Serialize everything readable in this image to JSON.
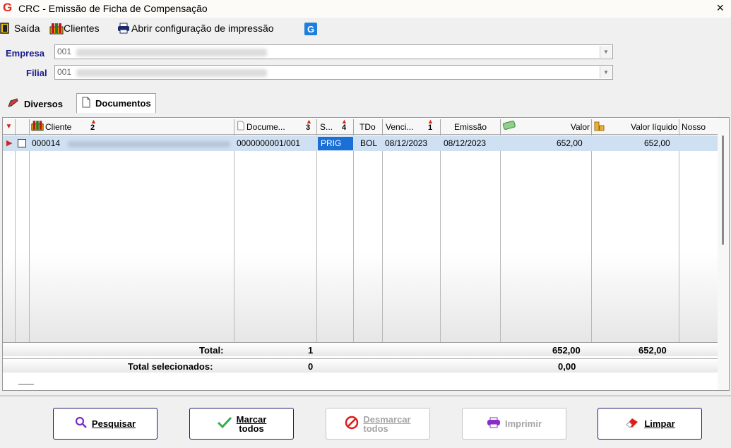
{
  "window": {
    "title": "CRC - Emissão de Ficha de Compensação",
    "close": "×"
  },
  "toolbar": {
    "exit_label": "Saída",
    "clients_label": "Clientes",
    "print_config_label": "Abrir configuração de impressão"
  },
  "form": {
    "empresa_label": "Empresa",
    "empresa_value": "001",
    "filial_label": "Filial",
    "filial_value": "001"
  },
  "tabs": [
    {
      "label": "Diversos"
    },
    {
      "label": "Documentos"
    }
  ],
  "grid": {
    "columns": [
      {
        "label": "Cliente",
        "sort": "2"
      },
      {
        "label": "Docume...",
        "sort": "3"
      },
      {
        "label": "S...",
        "sort": "4"
      },
      {
        "label": "TDo"
      },
      {
        "label": "Venci...",
        "sort": "1"
      },
      {
        "label": "Emissão"
      },
      {
        "label": "Valor"
      },
      {
        "label": "Valor líquido"
      },
      {
        "label": "Nosso"
      }
    ],
    "rows": [
      {
        "cliente_code": "000014",
        "documento": "0000000001/001",
        "situacao": "PRIG",
        "tdo": "BOL",
        "vencimento": "08/12/2023",
        "emissao": "08/12/2023",
        "valor": "652,00",
        "valor_liquido": "652,00"
      }
    ],
    "totals": {
      "total_label": "Total:",
      "total_count": "1",
      "total_valor": "652,00",
      "total_liquido": "652,00",
      "selected_label": "Total selecionados:",
      "selected_count": "0",
      "selected_valor": "0,00"
    }
  },
  "buttons": {
    "search": "Pesquisar",
    "mark_all_1": "Marcar",
    "mark_all_2": "todos",
    "unmark_all_1": "Desmarcar",
    "unmark_all_2": "todos",
    "print": "Imprimir",
    "clear": "Limpar"
  },
  "colors": {
    "accent": "#1a1a8a",
    "selected_row": "#cfe0f2",
    "status_highlight": "#1a6fd8",
    "sort_arrow": "#d2231a"
  }
}
